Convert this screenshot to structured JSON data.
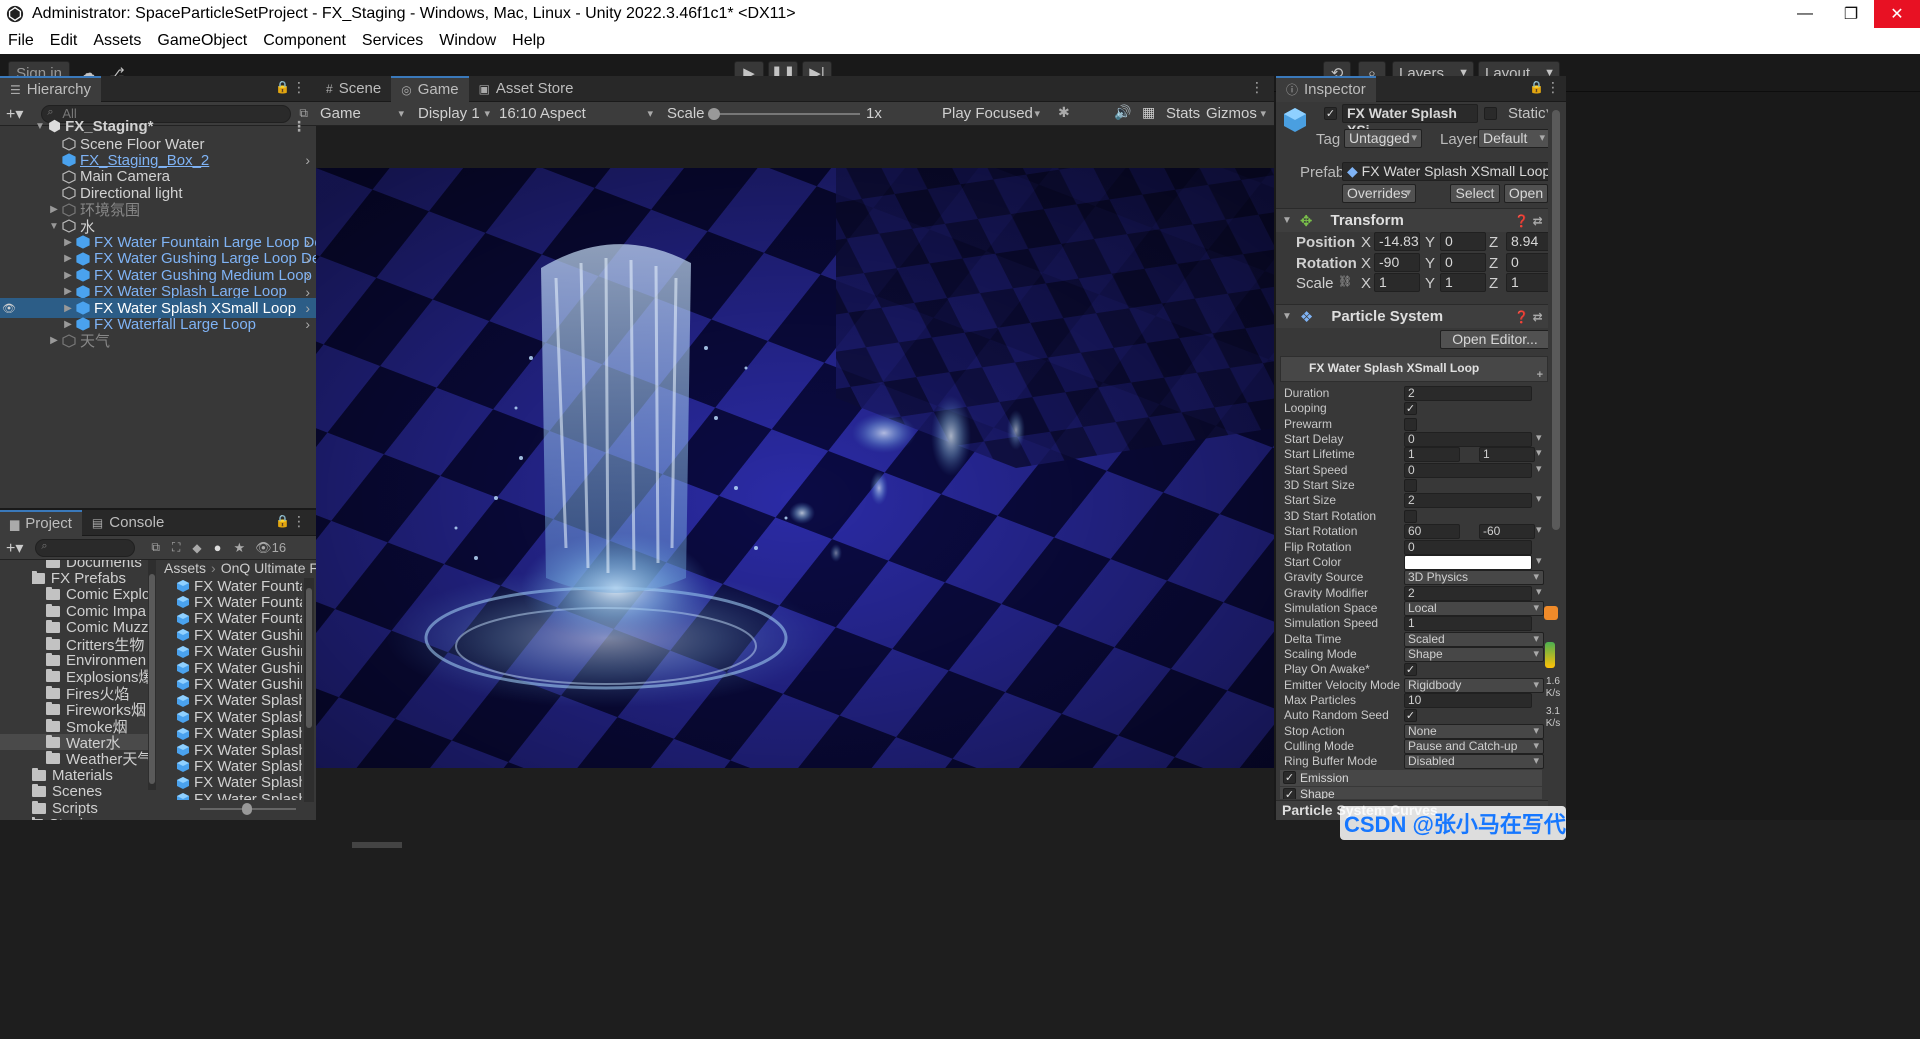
{
  "window": {
    "title": "Administrator: SpaceParticleSetProject - FX_Staging - Windows, Mac, Linux - Unity 2022.3.46f1c1* <DX11>",
    "minimize": "—",
    "maximize": "❐",
    "close": "✕"
  },
  "menu": [
    "File",
    "Edit",
    "Assets",
    "GameObject",
    "Component",
    "Services",
    "Window",
    "Help"
  ],
  "toolbar": {
    "sign_in": "Sign in",
    "layers": "Layers",
    "layout": "Layout"
  },
  "hierarchy": {
    "tab": "Hierarchy",
    "search_placeholder": "All",
    "scene": "FX_Staging*",
    "items": [
      {
        "label": "Scene Floor Water",
        "style": "normal"
      },
      {
        "label": "FX_Staging_Box_2",
        "style": "prefab"
      },
      {
        "label": "Main Camera",
        "style": "normal"
      },
      {
        "label": "Directional light",
        "style": "normal"
      },
      {
        "label": "环境氛围",
        "style": "disabled"
      },
      {
        "label": "水",
        "style": "normal"
      },
      {
        "label": "FX Water Fountain Large Loop Dem",
        "style": "prefab"
      },
      {
        "label": "FX Water Gushing Large Loop Dem",
        "style": "prefab"
      },
      {
        "label": "FX Water Gushing Medium Loop",
        "style": "prefab"
      },
      {
        "label": "FX Water Splash Large Loop",
        "style": "prefab"
      },
      {
        "label": "FX Water Splash XSmall Loop",
        "style": "selected"
      },
      {
        "label": "FX Waterfall Large Loop",
        "style": "prefab"
      },
      {
        "label": "天气",
        "style": "disabled"
      }
    ]
  },
  "viewtabs": {
    "scene": "Scene",
    "game": "Game",
    "asset_store": "Asset Store"
  },
  "gamebar": {
    "mode": "Game",
    "display": "Display 1",
    "aspect": "16:10 Aspect",
    "scale_label": "Scale",
    "scale_value": "1x",
    "play_focused": "Play Focused",
    "stats": "Stats",
    "gizmos": "Gizmos"
  },
  "project": {
    "tab_project": "Project",
    "tab_console": "Console",
    "hidden_count": "16",
    "tree": [
      {
        "label": "Documents",
        "indent": 2
      },
      {
        "label": "FX Prefabs",
        "indent": 1
      },
      {
        "label": "Comic Explo",
        "indent": 2
      },
      {
        "label": "Comic Impa",
        "indent": 2
      },
      {
        "label": "Comic Muzz",
        "indent": 2
      },
      {
        "label": "Critters生物",
        "indent": 2
      },
      {
        "label": "Environmen",
        "indent": 2
      },
      {
        "label": "Explosions爆",
        "indent": 2
      },
      {
        "label": "Fires火焰",
        "indent": 2
      },
      {
        "label": "Fireworks烟",
        "indent": 2
      },
      {
        "label": "Smoke烟",
        "indent": 2
      },
      {
        "label": "Water水",
        "indent": 2
      },
      {
        "label": "Weather天气",
        "indent": 2
      },
      {
        "label": "Materials",
        "indent": 1
      },
      {
        "label": "Scenes",
        "indent": 1
      },
      {
        "label": "Scripts",
        "indent": 1
      },
      {
        "label": "Staging",
        "indent": 1
      }
    ],
    "breadcrumb_root": "Assets",
    "breadcrumb_sub": "OnQ Ultimate FX",
    "assets": [
      "FX Water Fountain",
      "FX Water Fountain",
      "FX Water Fountain",
      "FX Water Gushing",
      "FX Water Gushing",
      "FX Water Gushing",
      "FX Water Gushing",
      "FX Water Splash L",
      "FX Water Splash L",
      "FX Water Splash M",
      "FX Water Splash M",
      "FX Water Splash S",
      "FX Water Splash S",
      "FX Water Splash X"
    ]
  },
  "inspector": {
    "tab": "Inspector",
    "object_name": "FX Water Splash XSi",
    "static_label": "Static",
    "tag_label": "Tag",
    "tag_value": "Untagged",
    "layer_label": "Layer",
    "layer_value": "Default",
    "prefab_label": "Prefab",
    "prefab_value": "FX Water Splash XSmall Loop",
    "overrides": "Overrides",
    "select": "Select",
    "open": "Open",
    "transform": {
      "title": "Transform",
      "position_label": "Position",
      "rotation_label": "Rotation",
      "scale_label": "Scale",
      "x": "X",
      "y": "Y",
      "z": "Z",
      "position": [
        "-14.83",
        "0",
        "8.94"
      ],
      "rotation": [
        "-90",
        "0",
        "0"
      ],
      "scale": [
        "1",
        "1",
        "1"
      ]
    },
    "particle": {
      "title": "Particle System",
      "open_editor": "Open Editor...",
      "module_title": "FX Water Splash XSmall Loop",
      "props": [
        {
          "label": "Duration",
          "value": "2",
          "kind": "text"
        },
        {
          "label": "Looping",
          "value": "✓",
          "kind": "check"
        },
        {
          "label": "Prewarm",
          "value": "",
          "kind": "check"
        },
        {
          "label": "Start Delay",
          "value": "0",
          "kind": "textdd"
        },
        {
          "label": "Start Lifetime",
          "value": "1",
          "value2": "1",
          "kind": "range"
        },
        {
          "label": "Start Speed",
          "value": "0",
          "kind": "textdd"
        },
        {
          "label": "3D Start Size",
          "value": "",
          "kind": "check"
        },
        {
          "label": "Start Size",
          "value": "2",
          "kind": "textdd"
        },
        {
          "label": "3D Start Rotation",
          "value": "",
          "kind": "check"
        },
        {
          "label": "Start Rotation",
          "value": "60",
          "value2": "-60",
          "kind": "range"
        },
        {
          "label": "Flip Rotation",
          "value": "0",
          "kind": "text"
        },
        {
          "label": "Start Color",
          "value": "",
          "kind": "color"
        },
        {
          "label": "Gravity Source",
          "value": "3D Physics",
          "kind": "dropdown"
        },
        {
          "label": "Gravity Modifier",
          "value": "2",
          "kind": "textdd"
        },
        {
          "label": "Simulation Space",
          "value": "Local",
          "kind": "dropdown"
        },
        {
          "label": "Simulation Speed",
          "value": "1",
          "kind": "text"
        },
        {
          "label": "Delta Time",
          "value": "Scaled",
          "kind": "dropdown"
        },
        {
          "label": "Scaling Mode",
          "value": "Shape",
          "kind": "dropdown"
        },
        {
          "label": "Play On Awake*",
          "value": "✓",
          "kind": "check"
        },
        {
          "label": "Emitter Velocity Mode",
          "value": "Rigidbody",
          "kind": "dropdown"
        },
        {
          "label": "Max Particles",
          "value": "10",
          "kind": "text"
        },
        {
          "label": "Auto Random Seed",
          "value": "✓",
          "kind": "check"
        },
        {
          "label": "Stop Action",
          "value": "None",
          "kind": "dropdown"
        },
        {
          "label": "Culling Mode",
          "value": "Pause and Catch-up",
          "kind": "dropdown"
        },
        {
          "label": "Ring Buffer Mode",
          "value": "Disabled",
          "kind": "dropdown"
        }
      ],
      "emission": "Emission",
      "shape": "Shape",
      "curves_title": "Particle System Curves"
    },
    "side_metrics": {
      "up": "1.6",
      "up_unit": "K/s",
      "down": "3.1",
      "down_unit": "K/s"
    }
  },
  "watermark": "CSDN @张小马在写代码",
  "colors": {
    "accent": "#3a79bb",
    "selected_row": "#2c5d87",
    "prefab_text": "#7fb3f5",
    "checker_dark": "#0b0b45",
    "checker_light": "#2b2ba6"
  }
}
